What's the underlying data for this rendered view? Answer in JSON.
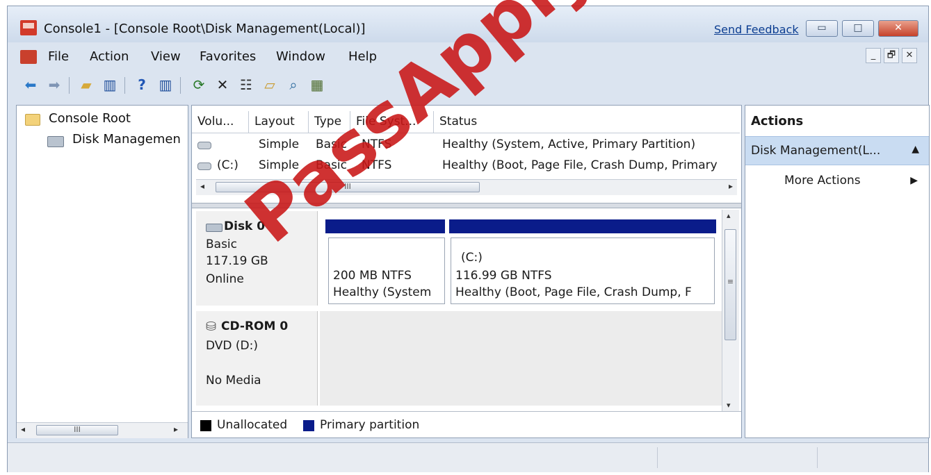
{
  "window": {
    "title": "Console1 - [Console Root\\Disk Management(Local)]",
    "send_feedback": "Send Feedback",
    "buttons": {
      "minimize": "▭",
      "maximize": "□",
      "close": "✕"
    }
  },
  "menu": {
    "items": [
      "File",
      "Action",
      "View",
      "Favorites",
      "Window",
      "Help"
    ],
    "mdi_buttons": [
      "_",
      "🗗",
      "✕"
    ]
  },
  "toolbar": {
    "icons": [
      "back-arrow-icon",
      "forward-arrow-icon",
      "up-folder-icon",
      "show-hide-tree-icon",
      "help-icon",
      "show-hide-action-pane-icon",
      "refresh-icon",
      "delete-icon",
      "properties-icon",
      "open-icon",
      "search-icon",
      "settings-icon"
    ]
  },
  "tree": {
    "items": [
      {
        "label": "Console Root"
      },
      {
        "label": "Disk Managemen"
      }
    ],
    "scroll_thumb": "III"
  },
  "volumes": {
    "columns": [
      "Volu...",
      "Layout",
      "Type",
      "File Syst...",
      "Status"
    ],
    "rows": [
      {
        "volume": "",
        "layout": "Simple",
        "type": "Basic",
        "fs": "NTFS",
        "status": "Healthy (System, Active, Primary Partition)"
      },
      {
        "volume": "(C:)",
        "layout": "Simple",
        "type": "Basic",
        "fs": "NTFS",
        "status": "Healthy (Boot, Page File, Crash Dump, Primary"
      }
    ],
    "scroll_thumb": "III"
  },
  "disks": [
    {
      "name": "Disk 0",
      "lines": [
        "Basic",
        "117.19 GB",
        "Online"
      ],
      "partitions": [
        {
          "label": "",
          "size": "200 MB NTFS",
          "status": "Healthy (System"
        },
        {
          "label": "(C:)",
          "size": "116.99 GB NTFS",
          "status": "Healthy (Boot, Page File, Crash Dump, F"
        }
      ]
    },
    {
      "name": "CD-ROM 0",
      "lines": [
        "DVD (D:)",
        "",
        "No Media"
      ]
    }
  ],
  "legend": [
    {
      "label": "Unallocated",
      "color": "#000000"
    },
    {
      "label": "Primary partition",
      "color": "#0a1c8a"
    }
  ],
  "actions": {
    "header": "Actions",
    "section": "Disk Management(L...",
    "items": [
      "More Actions"
    ]
  },
  "watermark": "PassApply.com",
  "colors": {
    "partition_header": "#0a1c8a",
    "watermark": "#c81616",
    "selection": "#c9dcf2"
  }
}
